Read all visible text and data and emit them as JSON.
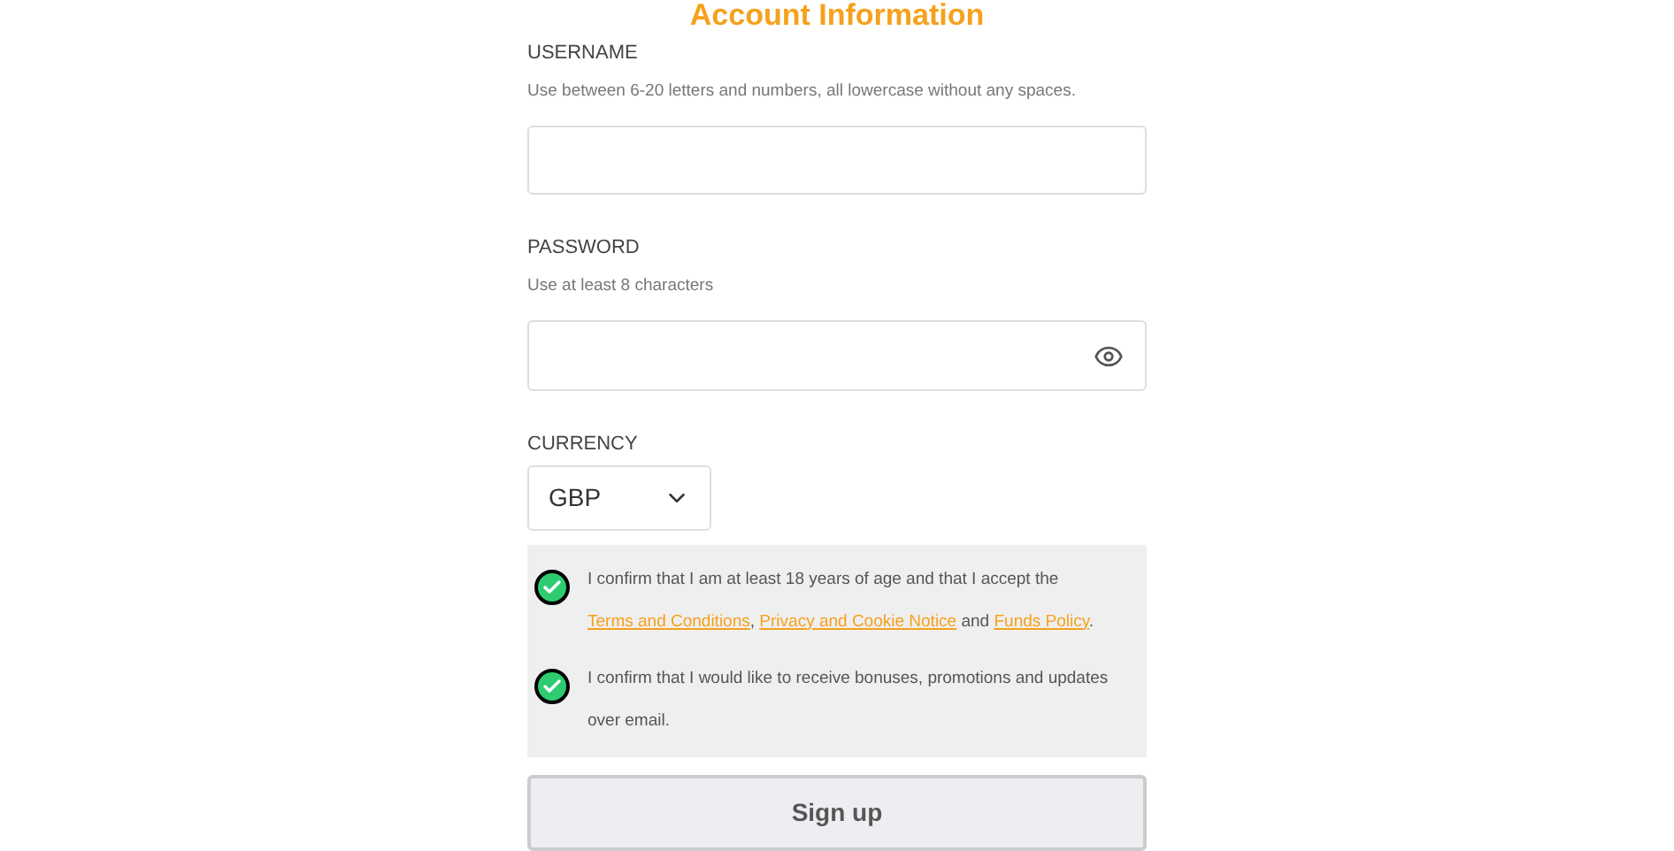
{
  "title": "Account Information",
  "username": {
    "label": "USERNAME",
    "hint": "Use between 6-20 letters and numbers, all lowercase without any spaces."
  },
  "password": {
    "label": "PASSWORD",
    "hint": "Use at least 8 characters"
  },
  "currency": {
    "label": "CURRENCY",
    "value": "GBP"
  },
  "consents": [
    {
      "checked": true,
      "parts": [
        {
          "kind": "text",
          "text": "I confirm that I am at least 18 years of age and that I accept the "
        },
        {
          "kind": "link",
          "text": "Terms and Conditions"
        },
        {
          "kind": "text",
          "text": ", "
        },
        {
          "kind": "link",
          "text": "Privacy and Cookie Notice"
        },
        {
          "kind": "text",
          "text": " and "
        },
        {
          "kind": "link",
          "text": "Funds Policy"
        },
        {
          "kind": "text",
          "text": "."
        }
      ]
    },
    {
      "checked": true,
      "parts": [
        {
          "kind": "text",
          "text": "I confirm that I would like to receive bonuses, promotions and updates over email."
        }
      ]
    }
  ],
  "submit": "Sign up"
}
